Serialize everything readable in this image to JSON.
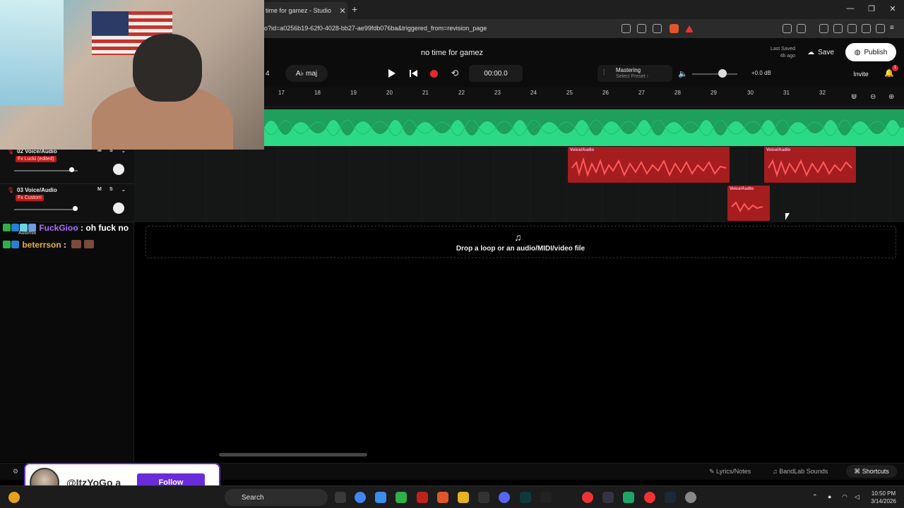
{
  "browser": {
    "tab_title": "time for gamez - Studio",
    "tab_close": "✕",
    "new_tab": "+",
    "url": "o?id=a0256b19-62f0-4028-bb27-ae99fdb076ba&triggered_from=revision_page",
    "window_controls": [
      "—",
      "❐",
      "✕"
    ]
  },
  "studio": {
    "project_title": "no time for gamez",
    "key_number": "4",
    "scale_label": "A♭ maj",
    "time_display": "00:00.0",
    "mastering_title": "Mastering",
    "mastering_sub": "Select Preset ›",
    "db_readout": "+0.0 dB",
    "last_saved_label": "Last Saved",
    "last_saved_time": "4h ago",
    "save_label": "Save",
    "publish_label": "Publish",
    "invite_label": "Invite",
    "notif_count": "1",
    "volume_level": 0.55
  },
  "ruler": {
    "ticks": [
      "17",
      "18",
      "19",
      "20",
      "21",
      "22",
      "23",
      "24",
      "25",
      "26",
      "27",
      "28",
      "29",
      "30",
      "31",
      "32"
    ]
  },
  "tracks": [
    {
      "name": "02  Voice/Audio",
      "fx": "Fx Lucki (edited)",
      "mute": "M",
      "solo": "S",
      "volume": 0.9
    },
    {
      "name": "03  Voice/Audio",
      "fx": "Fx Custom",
      "mute": "M",
      "solo": "S",
      "volume": 0.95
    }
  ],
  "regions": {
    "label": "Voice/Audio"
  },
  "drop_zone": {
    "text": "Drop a loop or an audio/MIDI/video file",
    "icon": "♫"
  },
  "automix_label": "Automix",
  "bottom_bar": {
    "lyrics": "Lyrics/Notes",
    "sounds": "BandLab Sounds",
    "shortcuts": "Shortcuts"
  },
  "chat": [
    {
      "user": "FuckGioo",
      "message": ": oh fuck no"
    },
    {
      "user": "beterrson",
      "message": ":"
    }
  ],
  "follow": {
    "handle": "@ItzYoGo a",
    "button": "Follow"
  },
  "taskbar": {
    "search_label": "Search",
    "time": "10:50 PM",
    "date": "3/14/2026"
  }
}
